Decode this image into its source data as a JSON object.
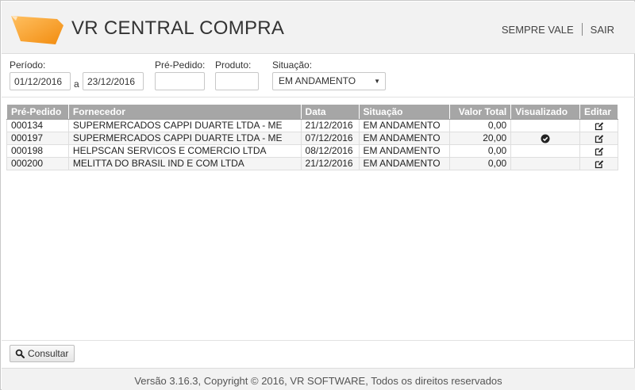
{
  "header": {
    "title": "VR CENTRAL COMPRA",
    "nav": [
      "SEMPRE VALE",
      "SAIR"
    ]
  },
  "filters": {
    "periodo_label": "Período:",
    "date_from": "01/12/2016",
    "between": "a",
    "date_to": "23/12/2016",
    "pre_pedido_label": "Pré-Pedido:",
    "pre_pedido_value": "",
    "produto_label": "Produto:",
    "produto_value": "",
    "situacao_label": "Situação:",
    "situacao_value": "EM ANDAMENTO"
  },
  "table": {
    "columns": [
      "Pré-Pedido",
      "Fornecedor",
      "Data",
      "Situação",
      "Valor Total",
      "Visualizado",
      "Editar"
    ],
    "rows": [
      {
        "pre_pedido": "000134",
        "fornecedor": "SUPERMERCADOS CAPPI DUARTE LTDA - ME",
        "data": "21/12/2016",
        "situacao": "EM ANDAMENTO",
        "valor": "0,00",
        "visualizado": false
      },
      {
        "pre_pedido": "000197",
        "fornecedor": "SUPERMERCADOS CAPPI DUARTE LTDA - ME",
        "data": "07/12/2016",
        "situacao": "EM ANDAMENTO",
        "valor": "20,00",
        "visualizado": true
      },
      {
        "pre_pedido": "000198",
        "fornecedor": "HELPSCAN SERVICOS E COMERCIO LTDA",
        "data": "08/12/2016",
        "situacao": "EM ANDAMENTO",
        "valor": "0,00",
        "visualizado": false
      },
      {
        "pre_pedido": "000200",
        "fornecedor": "MELITTA DO BRASIL IND E COM LTDA",
        "data": "21/12/2016",
        "situacao": "EM ANDAMENTO",
        "valor": "0,00",
        "visualizado": false
      }
    ]
  },
  "actions": {
    "consultar_label": "Consultar",
    "consultar_icon": "search-icon"
  },
  "footer": {
    "text": "Versão 3.16.3, Copyright © 2016, VR SOFTWARE, Todos os direitos reservados"
  },
  "colors": {
    "logo_orange": "#f7931e",
    "header_bg": "#f2f2f2",
    "table_header_bg": "#a6a6a6"
  }
}
